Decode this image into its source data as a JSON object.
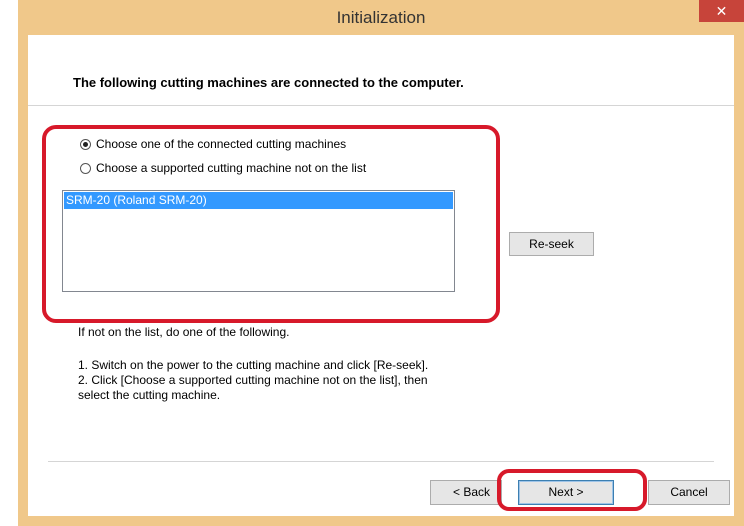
{
  "window": {
    "title": "Initialization",
    "close_glyph": "✕",
    "accent_color": "#f0c88a",
    "close_color": "#c7443a"
  },
  "header": {
    "text": "The following cutting machines are connected to the computer."
  },
  "options": {
    "connected_label": "Choose one of the connected cutting machines",
    "not_on_list_label": "Choose a supported cutting machine not on the list",
    "selected": "connected"
  },
  "machine_list": {
    "items": [
      "SRM-20 (Roland SRM-20)"
    ],
    "selected_index": 0
  },
  "buttons": {
    "reseek": "Re-seek",
    "back": "< Back",
    "next": "Next >",
    "cancel": "Cancel"
  },
  "instructions": {
    "intro": "If not on the list, do one of the following.",
    "step1": "1. Switch on the power to the cutting machine and click [Re-seek].",
    "step2_line1": "2. Click [Choose a supported cutting machine not on the list], then",
    "step2_line2": "select the cutting machine."
  },
  "highlight_color": "#d7192a"
}
